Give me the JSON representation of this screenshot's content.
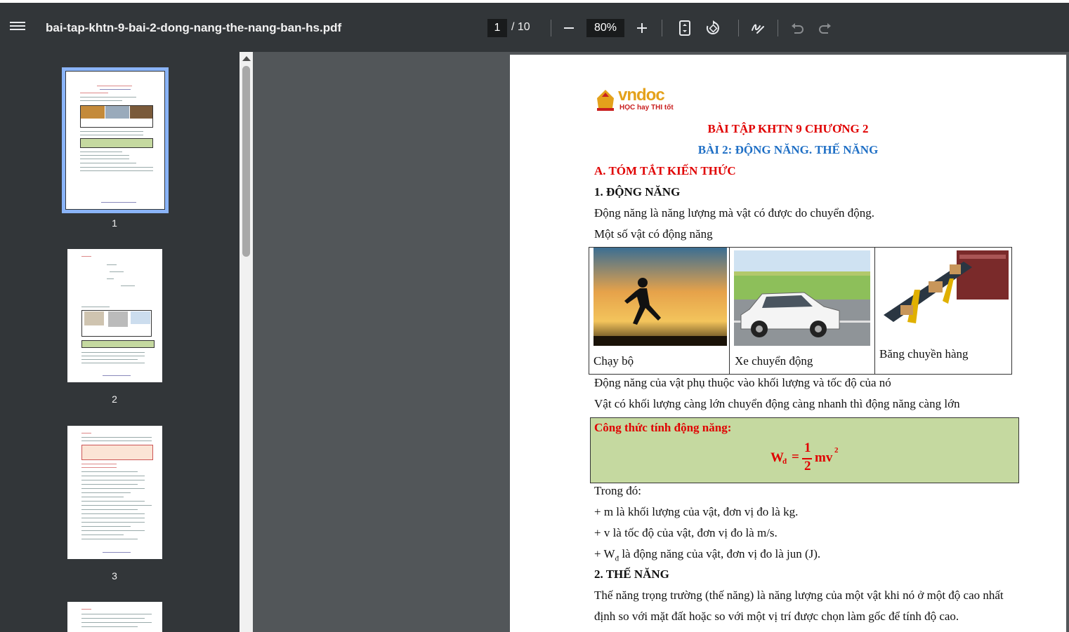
{
  "toolbar": {
    "file_name": "bai-tap-khtn-9-bai-2-dong-nang-the-nang-ban-hs.pdf",
    "current_page": "1",
    "total_pages": "/ 10",
    "zoom": "80%"
  },
  "sidebar": {
    "thumbnails": [
      {
        "number": "1"
      },
      {
        "number": "2"
      },
      {
        "number": "3"
      }
    ]
  },
  "document": {
    "logo_text": "vndoc",
    "logo_slogan": "HỌC hay THI tốt",
    "title": "BÀI TẬP KHTN 9 CHƯƠNG 2",
    "subtitle": "BÀI 2: ĐỘNG NĂNG. THẾ NĂNG",
    "section_a": "A. TÓM TẮT KIẾN THỨC",
    "heading_1": "1. ĐỘNG NĂNG",
    "def_kinetic": "Động năng là năng lượng mà vật có được do chuyển động.",
    "examples_intro": "Một số vật có động năng",
    "examples": [
      {
        "caption": "Chạy bộ"
      },
      {
        "caption": "Xe chuyển động"
      },
      {
        "caption": "Băng chuyền hàng"
      }
    ],
    "depends": "Động năng của vật phụ thuộc vào khối lượng và tốc độ của nó",
    "relation": "Vật có khối lượng càng lớn chuyển động càng nhanh thì động năng càng lớn",
    "formula_title": "Công thức tính động năng:",
    "formula": {
      "symbol": "W",
      "subscript": "đ",
      "equals": "=",
      "numerator": "1",
      "denominator": "2",
      "rhs": "mv",
      "power": "2"
    },
    "where": "Trong đó:",
    "bullet_m": "+ m là khối lượng của vật, đơn vị đo là kg.",
    "bullet_v": "+ v là tốc độ của vật, đơn vị đo là m/s.",
    "bullet_w_prefix": "+ W",
    "bullet_w_sub": "đ",
    "bullet_w_rest": " là động năng của vật, đơn vị đo là jun (J).",
    "heading_2": "2. THẾ NĂNG",
    "def_potential_1": "Thế năng trọng trường (thế năng) là năng lượng của một vật khi nó ở một độ cao nhất",
    "def_potential_2": "định so với mặt đất hoặc so với một vị trí được chọn làm gốc để tính độ cao."
  },
  "colors": {
    "toolbar_bg": "#323639",
    "viewer_bg": "#525659",
    "heading_red": "#e00000",
    "heading_blue": "#1f6fc5",
    "formula_bg": "#c5d9a0",
    "active_thumb": "#8ab4f8"
  },
  "icons": [
    "menu-icon",
    "minus-icon",
    "plus-icon",
    "fit-page-icon",
    "rotate-icon",
    "annotate-icon",
    "undo-icon",
    "redo-icon"
  ]
}
